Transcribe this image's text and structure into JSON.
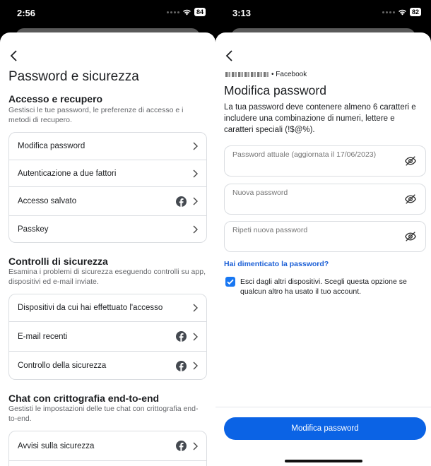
{
  "left": {
    "status": {
      "time": "2:56",
      "battery": "84"
    },
    "title": "Password e sicurezza",
    "sections": [
      {
        "title": "Accesso e recupero",
        "desc": "Gestisci le tue password, le preferenze di accesso e i metodi di recupero.",
        "items": [
          "Modifica password",
          "Autenticazione a due fattori",
          "Accesso salvato",
          "Passkey"
        ]
      },
      {
        "title": "Controlli di sicurezza",
        "desc": "Esamina i problemi di sicurezza eseguendo controlli su app, dispositivi ed e-mail inviate.",
        "items": [
          "Dispositivi da cui hai effettuato l'accesso",
          "E-mail recenti",
          "Controllo della sicurezza"
        ]
      },
      {
        "title": "Chat con crittografia end-to-end",
        "desc": "Gestisti le impostazioni delle tue chat con crittografia end-to-end.",
        "items": [
          "Avvisi sulla sicurezza"
        ]
      }
    ]
  },
  "right": {
    "status": {
      "time": "3:13",
      "battery": "82"
    },
    "brand": "• Facebook",
    "title": "Modifica password",
    "desc": "La tua password deve contenere almeno 6 caratteri e includere una combinazione di numeri, lettere e caratteri speciali (!$@%).",
    "fields": {
      "current": "Password attuale (aggiornata il 17/06/2023)",
      "new": "Nuova password",
      "repeat": "Ripeti nuova password"
    },
    "forgot": "Hai dimenticato la password?",
    "logout_others": "Esci dagli altri dispositivi. Scegli questa opzione se qualcun altro ha usato il tuo account.",
    "submit": "Modifica password"
  },
  "colors": {
    "accent": "#0b63e5",
    "link": "#1b5fd6",
    "border": "#dadde1"
  }
}
